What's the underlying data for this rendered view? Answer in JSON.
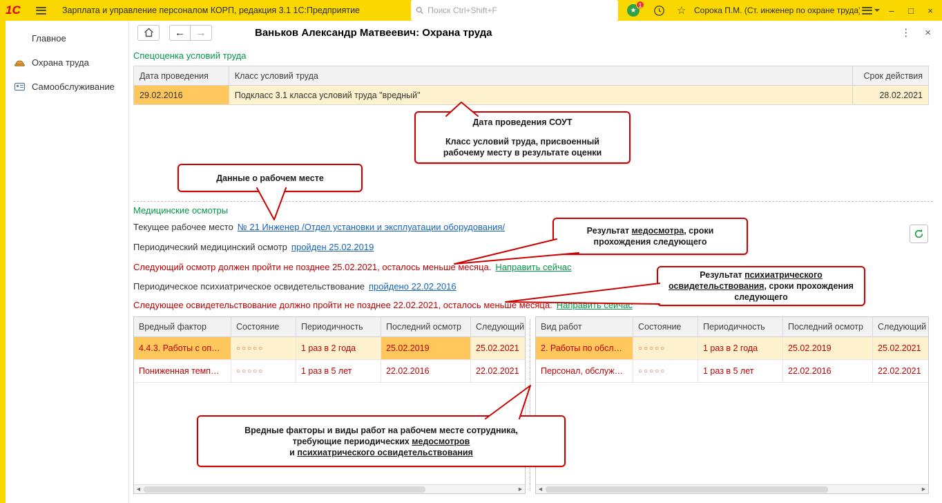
{
  "app": {
    "logo": "1С",
    "title": "Зарплата и управление персоналом КОРП, редакция 3.1 1С:Предприятие",
    "search_placeholder": "Поиск Ctrl+Shift+F",
    "notification_badge": "1",
    "user_name": "Сорока П.М. (Ст. инженер по охране труда)"
  },
  "icons": {
    "back": "←",
    "forward": "→",
    "more": "⋮",
    "window_close": "×",
    "minimize": "–",
    "maximize": "□",
    "star_outline": "☆",
    "star_filled": "★",
    "scroll_left": "◀",
    "scroll_right": "▶"
  },
  "colors": {
    "brand_yellow": "#fbd700",
    "accent_green": "#009846",
    "warning_red": "#c00000",
    "highlight_row": "#fdf2cd",
    "highlight_cell": "#ffc75c",
    "link_blue": "#1464c0",
    "callout_red": "#cc0000"
  },
  "sidebar": {
    "items": [
      {
        "label": "Главное"
      },
      {
        "label": "Охрана труда"
      },
      {
        "label": "Самообслуживание"
      }
    ]
  },
  "page": {
    "title": "Ваньков Александр Матвеевич: Охрана труда"
  },
  "sout": {
    "title": "Спецоценка условий труда",
    "columns": [
      "Дата проведения",
      "Класс условий труда",
      "Срок действия"
    ],
    "row": {
      "date": "29.02.2016",
      "class": "Подкласс 3.1 класса условий труда \"вредный\"",
      "valid_until": "28.02.2021"
    }
  },
  "medical": {
    "title": "Медицинские осмотры",
    "workplace_label": "Текущее рабочее место",
    "workplace_link": "№ 21 Инженер /Отдел установки и эксплуатации оборудования/",
    "exam_label": "Периодический медицинский осмотр",
    "exam_link": "пройден 25.02.2019",
    "exam_warning": "Следующий осмотр должен пройти не позднее 25.02.2021, осталось меньше месяца.",
    "exam_action": "Направить сейчас",
    "psych_label": "Периодическое психиатрическое освидетельствование",
    "psych_link": "пройдено 22.02.2016",
    "psych_warning": "Следующее освидетельствование должно пройти не позднее 22.02.2021, осталось меньше месяца.",
    "psych_action": "Направить сейчас"
  },
  "factors_table": {
    "columns": [
      "Вредный фактор",
      "Состояние",
      "Периодичность",
      "Последний осмотр",
      "Следующий"
    ],
    "rows": [
      {
        "name": "4.4.3. Работы с оп…",
        "state": "○○○○○",
        "period": "1 раз в 2 года",
        "last": "25.02.2019",
        "next": "25.02.2021"
      },
      {
        "name": "Пониженная темп…",
        "state": "○○○○○",
        "period": "1 раз в 5 лет",
        "last": "22.02.2016",
        "next": "22.02.2021"
      }
    ]
  },
  "works_table": {
    "columns": [
      "Вид работ",
      "Состояние",
      "Периодичность",
      "Последний осмотр",
      "Следующий"
    ],
    "rows": [
      {
        "name": "2. Работы по обсл…",
        "state": "○○○○○",
        "period": "1 раз в 2 года",
        "last": "25.02.2019",
        "next": "25.02.2021"
      },
      {
        "name": "Персонал, обслуж…",
        "state": "○○○○○",
        "period": "1 раз в 5 лет",
        "last": "22.02.2016",
        "next": "22.02.2021"
      }
    ]
  },
  "callouts": {
    "sout": {
      "line1": "Дата проведения СОУТ",
      "line2": "Класс условий труда, присвоенный",
      "line3": "рабочему месту в результате оценки"
    },
    "workplace": {
      "text": "Данные о рабочем месте"
    },
    "exam": {
      "l1a": "Результат ",
      "l1b": "медосмотра",
      "l1c": ", сроки",
      "l2": "прохождения следующего"
    },
    "psych": {
      "l1a": "Результат ",
      "l1b": "психиатрического",
      "l2a": "освидетельствования",
      "l2b": ", сроки прохождения",
      "l3": "следующего"
    },
    "bottom": {
      "l1": "Вредные факторы и виды работ на рабочем месте сотрудника,",
      "l2a": "требующие периодических ",
      "l2b": "медосмотров",
      "l3a": "и ",
      "l3b": "психиатрического освидетельствования"
    }
  }
}
